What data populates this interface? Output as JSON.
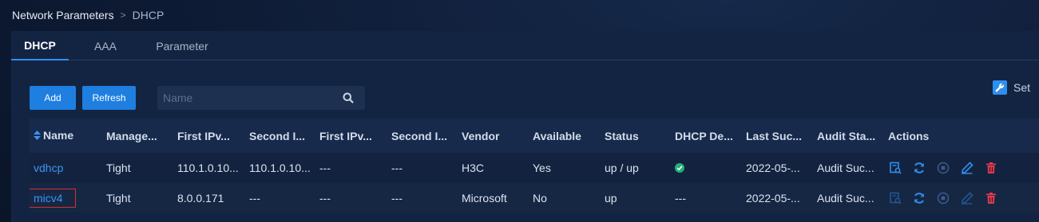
{
  "breadcrumb": {
    "parent": "Network Parameters",
    "separator": ">",
    "current": "DHCP"
  },
  "tabs": [
    {
      "label": "DHCP",
      "active": true
    },
    {
      "label": "AAA",
      "active": false
    },
    {
      "label": "Parameter",
      "active": false
    }
  ],
  "toolbar": {
    "add_label": "Add",
    "refresh_label": "Refresh",
    "set_label": "Set"
  },
  "search": {
    "placeholder": "Name",
    "value": ""
  },
  "table": {
    "headers": [
      "Name",
      "Manage...",
      "First IPv...",
      "Second I...",
      "First IPv...",
      "Second I...",
      "Vendor",
      "Available",
      "Status",
      "DHCP De...",
      "Last Suc...",
      "Audit Sta...",
      "Actions"
    ],
    "rows": [
      {
        "name": "vdhcp",
        "management": "Tight",
        "first_ipv4": "110.1.0.10...",
        "second_ipv4": "110.1.0.10...",
        "first_ipv6": "---",
        "second_ipv6": "---",
        "vendor": "H3C",
        "available": "Yes",
        "status": "up / up",
        "dhcp_detect": "ok",
        "last_success": "2022-05-...",
        "audit_status": "Audit Suc..."
      },
      {
        "name": "micv4",
        "management": "Tight",
        "first_ipv4": "8.0.0.171",
        "second_ipv4": "---",
        "first_ipv6": "---",
        "second_ipv6": "---",
        "vendor": "Microsoft",
        "available": "No",
        "status": "up",
        "dhcp_detect": "---",
        "last_success": "2022-05-...",
        "audit_status": "Audit Suc..."
      }
    ]
  },
  "colors": {
    "accent": "#2f8ff0",
    "link": "#3b94f2",
    "danger": "#e5394a",
    "success": "#22b27a",
    "highlight_border": "#d8302f"
  },
  "icons": [
    "search-icon",
    "wrench-icon",
    "sort-icon",
    "check-circle-icon",
    "audit-icon",
    "sync-icon",
    "stop-icon",
    "edit-icon",
    "delete-icon"
  ]
}
